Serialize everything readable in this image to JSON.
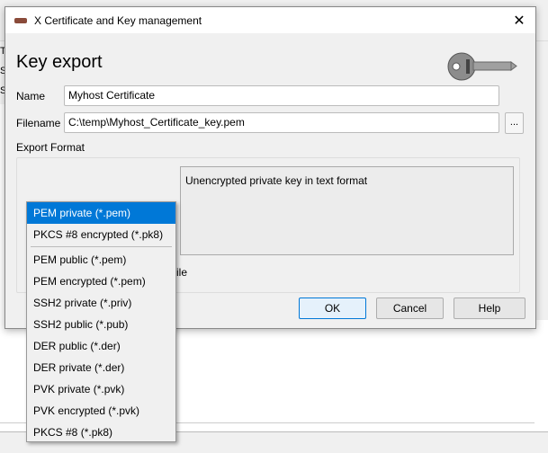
{
  "background": {
    "left_letters": [
      "T",
      "S",
      "S"
    ]
  },
  "dialog": {
    "title": "X Certificate and Key management",
    "heading": "Key export",
    "name_label": "Name",
    "name_value": "Myhost Certificate",
    "filename_label": "Filename",
    "filename_value": "C:\\temp\\Myhost_Certificate_key.pem",
    "browse_label": "...",
    "export_format_label": "Export Format",
    "description": "Unencrypted private key in text format",
    "checkbox_partial": "ile",
    "ok_label": "OK",
    "cancel_label": "Cancel",
    "help_label": "Help"
  },
  "dropdown": {
    "selected": "PEM private (*.pem)",
    "items": [
      "PEM private (*.pem)",
      "PKCS #8 encrypted (*.pk8)",
      "PEM public (*.pem)",
      "PEM encrypted (*.pem)",
      "SSH2 private (*.priv)",
      "SSH2 public (*.pub)",
      "DER public (*.der)",
      "DER private (*.der)",
      "PVK private (*.pvk)",
      "PVK encrypted (*.pvk)",
      "PKCS #8 (*.pk8)"
    ]
  },
  "colors": {
    "accent": "#0078d7"
  }
}
